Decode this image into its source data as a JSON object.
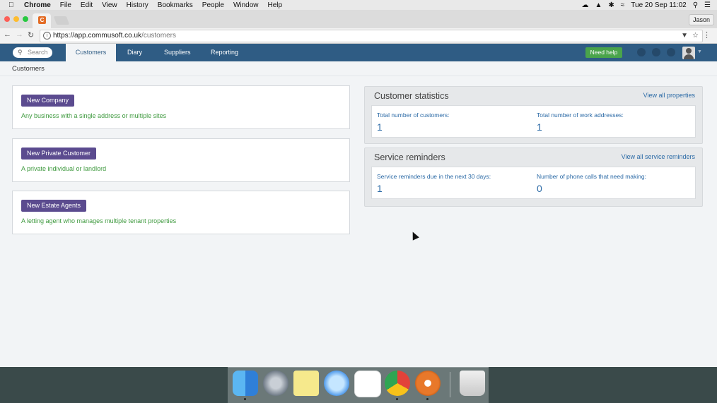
{
  "menubar": {
    "app_name": "Chrome",
    "items": [
      "File",
      "Edit",
      "View",
      "History",
      "Bookmarks",
      "People",
      "Window",
      "Help"
    ],
    "clock": "Tue 20 Sep  11:02"
  },
  "browser": {
    "profile_name": "Jason",
    "tab_favicon": "C",
    "url_host": "https://app.commusoft.co.uk",
    "url_path": "/customers"
  },
  "app_nav": {
    "search_placeholder": "Search",
    "tabs": [
      "Customers",
      "Diary",
      "Suppliers",
      "Reporting"
    ],
    "active_tab": "Customers",
    "help_button": "Need help"
  },
  "page": {
    "breadcrumb": "Customers"
  },
  "cards": [
    {
      "button": "New Company",
      "description": "Any business with a single address or multiple sites"
    },
    {
      "button": "New Private Customer",
      "description": "A private individual or landlord"
    },
    {
      "button": "New Estate Agents",
      "description": "A letting agent who manages multiple tenant properties"
    }
  ],
  "customer_statistics": {
    "title": "Customer statistics",
    "link": "View all properties",
    "stats": [
      {
        "label": "Total number of customers:",
        "value": "1"
      },
      {
        "label": "Total number of work addresses:",
        "value": "1"
      }
    ]
  },
  "service_reminders": {
    "title": "Service reminders",
    "link": "View all service reminders",
    "stats": [
      {
        "label": "Service reminders due in the next 30 days:",
        "value": "1"
      },
      {
        "label": "Number of phone calls that need making:",
        "value": "0"
      }
    ]
  },
  "dock": {
    "apps": [
      "finder-icon",
      "launchpad-icon",
      "notes-icon",
      "messages-icon",
      "slack-icon",
      "chrome-icon",
      "commusoft-icon",
      "trash-icon"
    ]
  },
  "colors": {
    "nav_bar": "#2f5c84",
    "primary_button": "#5b4b8f",
    "help_button": "#4aa44b",
    "link": "#2b6aa6",
    "description_text": "#3f9a3f"
  }
}
